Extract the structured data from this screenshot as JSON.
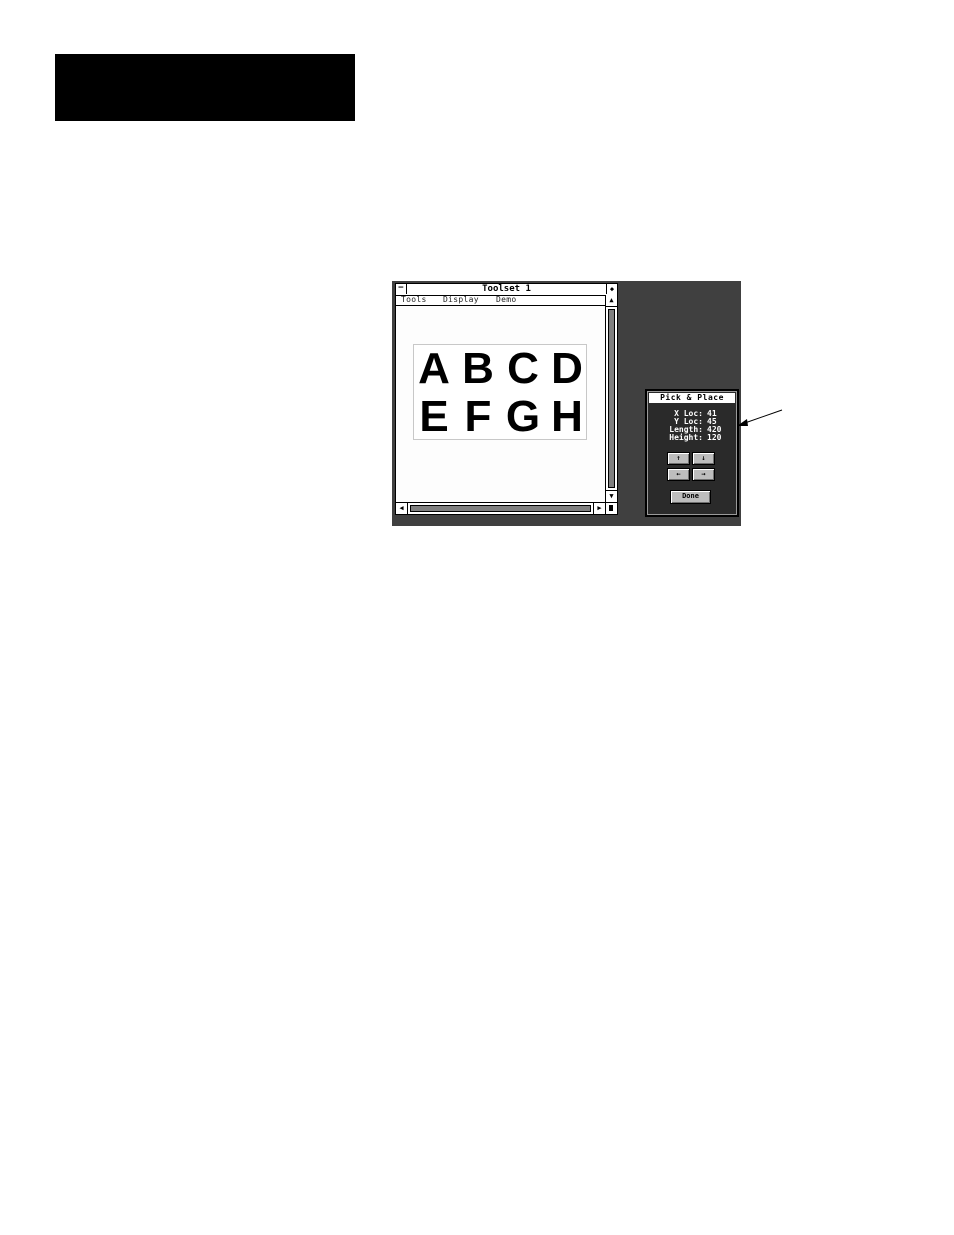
{
  "toolset_window": {
    "title": "Toolset 1",
    "menu": [
      "Tools",
      "Display",
      "Demo"
    ],
    "sample_letters": [
      "A",
      "B",
      "C",
      "D",
      "E",
      "F",
      "G",
      "H"
    ]
  },
  "pick_place_dialog": {
    "title": "Pick & Place",
    "fields": [
      {
        "label": "X Loc:",
        "value": "41"
      },
      {
        "label": "Y Loc:",
        "value": "45"
      },
      {
        "label": "Length:",
        "value": "420"
      },
      {
        "label": "Height:",
        "value": "120"
      }
    ],
    "arrows": {
      "up": "↑",
      "down": "↓",
      "left": "←",
      "right": "→"
    },
    "done_label": "Done"
  },
  "icons": {
    "system_menu": "−",
    "maximize": "◆",
    "scroll_up": "▲",
    "scroll_down": "▼",
    "scroll_left": "◀",
    "scroll_right": "▶"
  }
}
